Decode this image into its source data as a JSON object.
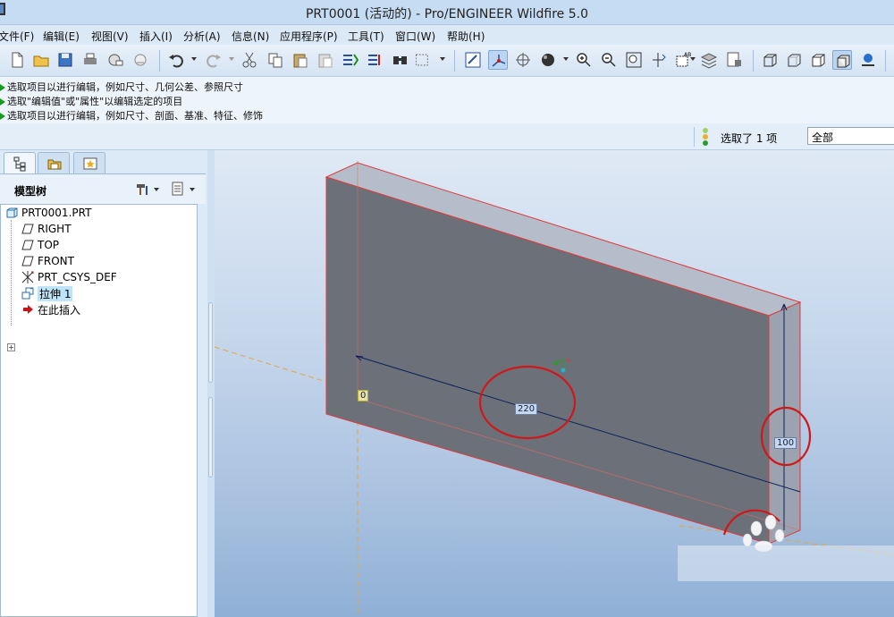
{
  "window": {
    "title": "PRT0001 (活动的) - Pro/ENGINEER Wildfire 5.0"
  },
  "menu": [
    "文件(F)",
    "编辑(E)",
    "视图(V)",
    "插入(I)",
    "分析(A)",
    "信息(N)",
    "应用程序(P)",
    "工具(T)",
    "窗口(W)",
    "帮助(H)"
  ],
  "messages": [
    "选取项目以进行编辑，例如尺寸、几何公差、参照尺寸",
    "选取\"编辑值\"或\"属性\"以编辑选定的项目",
    "选取项目以进行编辑，例如尺寸、剖面、基准、特征、修饰"
  ],
  "status": {
    "selection_count": "选取了 1 项",
    "filter_value": "全部"
  },
  "model_tree": {
    "header": "模型树",
    "items": [
      {
        "label": "PRT0001.PRT",
        "icon": "part-icon"
      },
      {
        "label": "RIGHT",
        "icon": "datum-plane-icon"
      },
      {
        "label": "TOP",
        "icon": "datum-plane-icon"
      },
      {
        "label": "FRONT",
        "icon": "datum-plane-icon"
      },
      {
        "label": "PRT_CSYS_DEF",
        "icon": "csys-icon"
      },
      {
        "label": "拉伸 1",
        "icon": "extrude-icon"
      },
      {
        "label": "在此插入",
        "icon": "insert-here-arrow-icon"
      }
    ]
  },
  "viewport": {
    "dimensions": [
      {
        "value": "220"
      },
      {
        "value": "100"
      },
      {
        "value": "0"
      }
    ],
    "colors": {
      "model_face": "#6b7079",
      "edge": "#e03a3a",
      "annotation_circle": "#d01818",
      "dimension_line": "#10205a"
    }
  }
}
